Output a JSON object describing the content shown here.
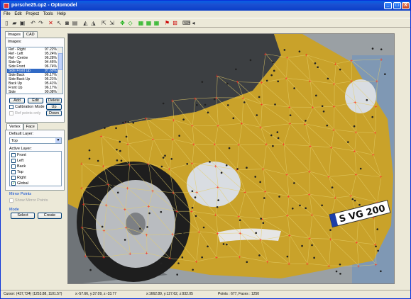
{
  "window": {
    "title": "porsche25.op2 - Optomodel"
  },
  "titlebar_buttons": [
    "_",
    "□",
    "X"
  ],
  "menu": [
    "File",
    "Edit",
    "Project",
    "Tools",
    "Help"
  ],
  "left_tabs": [
    "Images",
    "CAD"
  ],
  "images_label": "Images:",
  "images": [
    {
      "name": "Ref - Right",
      "pct": "97.22%"
    },
    {
      "name": "Ref - Left",
      "pct": "95.24%"
    },
    {
      "name": "Ref - Centre",
      "pct": "96.28%"
    },
    {
      "name": "Side Up",
      "pct": "94.46%"
    },
    {
      "name": "Side Front",
      "pct": "96.74%"
    },
    {
      "name": "Side Front Up",
      "pct": "97.69%"
    },
    {
      "name": "Side Back",
      "pct": "96.17%"
    },
    {
      "name": "Side Back Up",
      "pct": "95.21%"
    },
    {
      "name": "Back Up",
      "pct": "95.41%"
    },
    {
      "name": "Front Up",
      "pct": "96.17%"
    },
    {
      "name": "Side",
      "pct": "90.08%"
    }
  ],
  "image_buttons": {
    "add": "Add",
    "edit": "Edit",
    "delete": "Delete",
    "up": "Up",
    "down": "Down"
  },
  "calibration_mode": "Calibration Mode",
  "ref_points_only": "Ref points only",
  "lower_tabs": [
    "Vertex",
    "Face"
  ],
  "default_layer_label": "Default Layer:",
  "default_layer_value": "Top",
  "active_layer_label": "Active Layer:",
  "layers": [
    {
      "name": "Front",
      "checked": false
    },
    {
      "name": "Left",
      "checked": false
    },
    {
      "name": "Back",
      "checked": false
    },
    {
      "name": "Top",
      "checked": false
    },
    {
      "name": "Right",
      "checked": false
    },
    {
      "name": "Global",
      "checked": true
    }
  ],
  "mirror_points_title": "Mirror Points",
  "show_mirror_points": "Show Mirror Points",
  "mode_title": "Mode",
  "mode_buttons": {
    "select": "Select",
    "create": "Create"
  },
  "viewport": {
    "plate_text": "S  VG 200"
  },
  "status": {
    "cursor": "Cursor: (437,724) (1253.88, 1101.57)",
    "xyz": "x:-57.66, y:37.09, z:-33.77",
    "xyz2": "x:1662.89, y:127.62, z:932.05",
    "counts": "Points : 677, Faces : 1250"
  },
  "colors": {
    "car": "#c9a22a",
    "mesh": "#e6cf6a",
    "point": "#ff1a1a",
    "selection": "#316ac5"
  }
}
